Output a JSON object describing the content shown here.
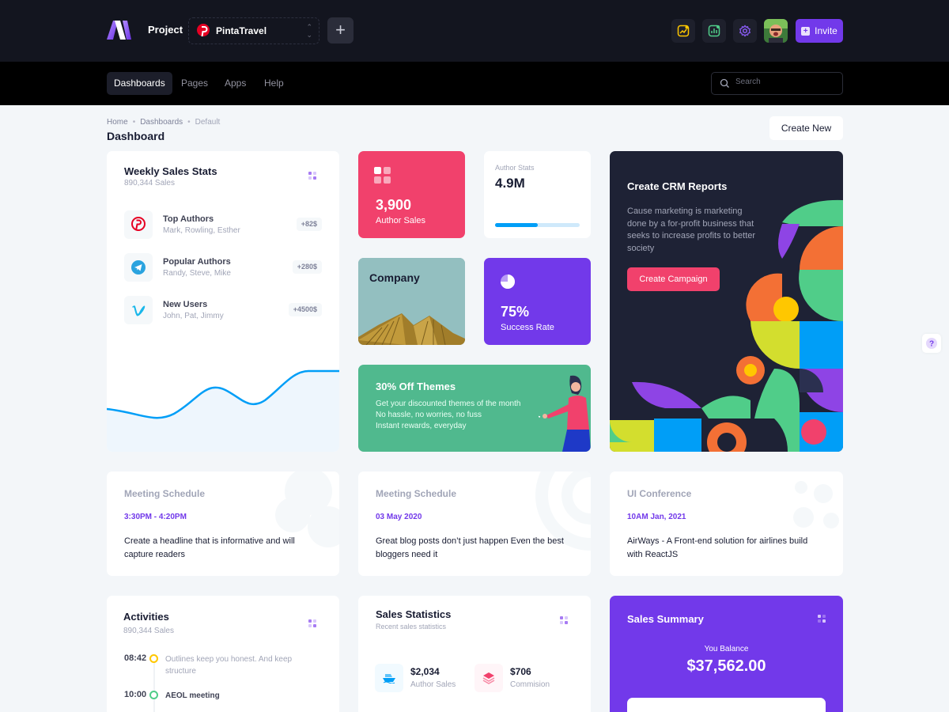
{
  "header": {
    "project_label": "Project",
    "project_name": "PintaTravel",
    "add_label": "+",
    "invite_label": "Invite",
    "icons": [
      "trend-icon",
      "chart-icon",
      "gear-icon"
    ]
  },
  "nav": {
    "items": [
      {
        "label": "Dashboards",
        "active": true
      },
      {
        "label": "Pages",
        "active": false
      },
      {
        "label": "Apps",
        "active": false
      },
      {
        "label": "Help",
        "active": false
      }
    ],
    "search_placeholder": "Search"
  },
  "toolbar": {
    "breadcrumb": [
      "Home",
      "Dashboards",
      "Default"
    ],
    "title": "Dashboard",
    "create_label": "Create New"
  },
  "weekly_sales": {
    "title": "Weekly Sales Stats",
    "subtitle": "890,344 Sales",
    "items": [
      {
        "name": "Top Authors",
        "people": "Mark, Rowling, Esther",
        "badge": "+82$"
      },
      {
        "name": "Popular Authors",
        "people": "Randy, Steve, Mike",
        "badge": "+280$"
      },
      {
        "name": "New Users",
        "people": "John, Pat, Jimmy",
        "badge": "+4500$"
      }
    ]
  },
  "author_sales": {
    "value": "3,900",
    "label": "Author Sales"
  },
  "author_stats": {
    "label": "Author Stats",
    "value": "4.9M",
    "progress": 0.5
  },
  "company": {
    "label": "Company"
  },
  "success": {
    "value": "75%",
    "label": "Success Rate"
  },
  "themes": {
    "title": "30% Off Themes",
    "lines": [
      "Get your discounted themes of the month",
      "No hassle, no worries, no fuss",
      "Instant rewards, everyday"
    ]
  },
  "crm": {
    "title": "Create CRM Reports",
    "description": "Cause marketing is marketing done by a for-profit business that seeks to increase profits to better society",
    "button": "Create Campaign"
  },
  "meetings": [
    {
      "title": "Meeting Schedule",
      "date": "3:30PM - 4:20PM",
      "text": "Create a headline that is informative and will capture readers"
    },
    {
      "title": "Meeting Schedule",
      "date": "03 May 2020",
      "text": "Great blog posts don’t just happen Even the best bloggers need it"
    },
    {
      "title": "UI Conference",
      "date": "10AM Jan, 2021",
      "text": "AirWays - A Front-end solution for airlines build with ReactJS"
    }
  ],
  "activities": {
    "title": "Activities",
    "subtitle": "890,344 Sales",
    "items": [
      {
        "time": "08:42",
        "text": "Outlines keep you honest. And keep structure",
        "color": "#ffc700"
      },
      {
        "time": "10:00",
        "text": "AEOL meeting",
        "color": "#50cd89"
      }
    ]
  },
  "sales_stats": {
    "title": "Sales Statistics",
    "subtitle": "Recent sales statistics",
    "items": [
      {
        "value": "$2,034",
        "label": "Author Sales"
      },
      {
        "value": "$706",
        "label": "Commision"
      }
    ]
  },
  "sales_summary": {
    "title": "Sales Summary",
    "balance_label": "You Balance",
    "balance": "$37,562.00"
  },
  "colors": {
    "primary": "#7239ea",
    "danger": "#f1416c",
    "success": "#50cd89",
    "info": "#009ef7",
    "dark": "#1e2235"
  }
}
